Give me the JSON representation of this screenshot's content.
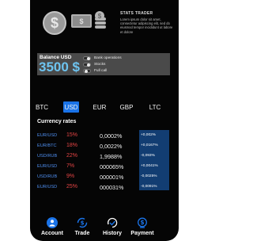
{
  "header": {
    "title": "STATS TRADER",
    "description": "Lorem ipsum dolor sit amet, consectetur adipiscing elit, sed do eiusmod tempor incididunt ut labore et dolore",
    "icons": [
      "dollar-coin-icon",
      "cash-icon",
      "coin-stack-icon"
    ]
  },
  "balance": {
    "label": "Balance USD",
    "value": "3500 $",
    "options": [
      {
        "label": "Bank operations",
        "on": true
      },
      {
        "label": "Stocks",
        "on": true
      },
      {
        "label": "Full call",
        "on": false
      }
    ]
  },
  "tabs": [
    {
      "label": "BTC",
      "active": false
    },
    {
      "label": "USD",
      "active": true
    },
    {
      "label": "EUR",
      "active": false
    },
    {
      "label": "GBP",
      "active": false
    },
    {
      "label": "LTC",
      "active": false
    }
  ],
  "rates": {
    "title": "Currency rates",
    "rows": [
      {
        "pair": "EUR/USD",
        "pct": "15%",
        "value": "0,0002%",
        "change": "+0,002%"
      },
      {
        "pair": "EUR/BTC",
        "pct": "18%",
        "value": "0,0022%",
        "change": "+0,0167%"
      },
      {
        "pair": "USD/RUB",
        "pct": "22%",
        "value": "1,9988%",
        "change": "-0,093%"
      },
      {
        "pair": "EUR/USD",
        "pct": "7%",
        "value": "000065%",
        "change": "+0,0041%"
      },
      {
        "pair": "USD/RUB",
        "pct": "9%",
        "value": "000001%",
        "change": "-0,0025%"
      },
      {
        "pair": "EUR/USD",
        "pct": "25%",
        "value": "000031%",
        "change": "-0,0091%"
      }
    ]
  },
  "nav": [
    {
      "label": "Account",
      "icon": "user-icon",
      "color": "#1a73e8"
    },
    {
      "label": "Trade",
      "icon": "exchange-icon",
      "color": "#1a73e8"
    },
    {
      "label": "History",
      "icon": "history-icon",
      "color": "#ffffff"
    },
    {
      "label": "Payment",
      "icon": "payment-icon",
      "color": "#1a73e8"
    }
  ],
  "colors": {
    "accent": "#1a73e8",
    "balance_value": "#6ec4f0",
    "pct_red": "#e64545",
    "pair_blue": "#4f8ff0"
  }
}
